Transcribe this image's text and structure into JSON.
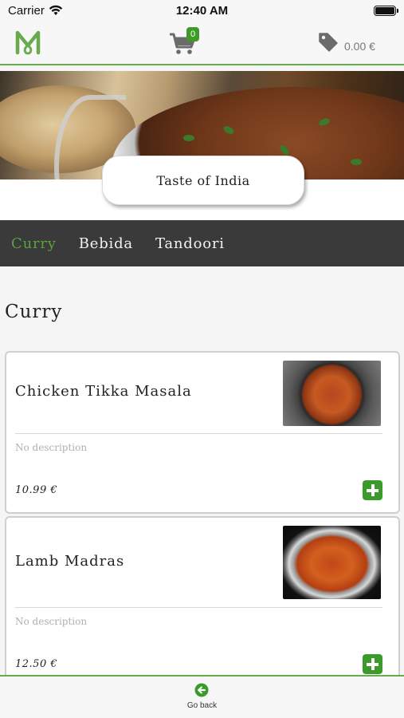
{
  "status_bar": {
    "carrier": "Carrier",
    "time": "12:40 AM"
  },
  "header": {
    "logo_icon": "restaurant-logo-m",
    "cart_count": "0",
    "total": "0.00 €",
    "accent_color": "#6aaa4e"
  },
  "restaurant": {
    "name": "Taste of India"
  },
  "tabs": [
    {
      "label": "Curry",
      "active": true
    },
    {
      "label": "Bebida",
      "active": false
    },
    {
      "label": "Tandoori",
      "active": false
    }
  ],
  "section": {
    "title": "Curry"
  },
  "items": [
    {
      "name": "Chicken Tikka Masala",
      "description": "No description",
      "price": "10.99 €"
    },
    {
      "name": "Lamb Madras",
      "description": "No description",
      "price": "12.50 €"
    }
  ],
  "footer": {
    "back_label": "Go back"
  },
  "colors": {
    "brand_green": "#3a9b2a",
    "active_tab": "#59a23c",
    "tab_bar": "#3a3a3a"
  }
}
